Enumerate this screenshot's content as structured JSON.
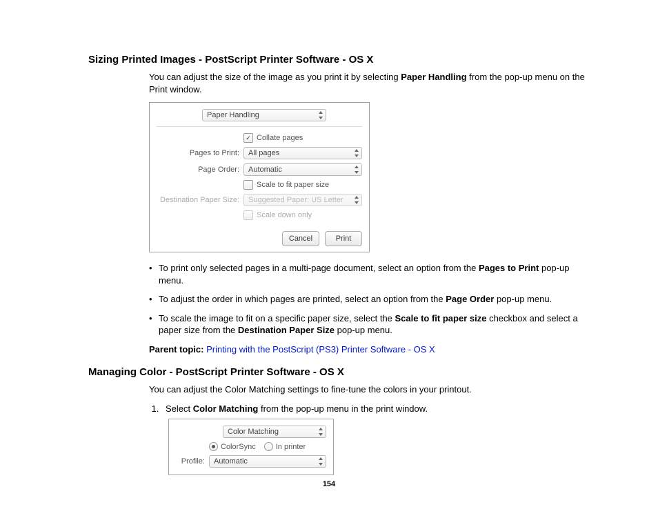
{
  "section1": {
    "heading": "Sizing Printed Images - PostScript Printer Software - OS X",
    "intro_pre": "You can adjust the size of the image as you print it by selecting ",
    "intro_bold": "Paper Handling",
    "intro_post": " from the pop-up menu on the Print window.",
    "dialog": {
      "menu": "Paper Handling",
      "collate": "Collate pages",
      "pages_label": "Pages to Print:",
      "pages_value": "All pages",
      "order_label": "Page Order:",
      "order_value": "Automatic",
      "scale_fit": "Scale to fit paper size",
      "dest_label": "Destination Paper Size:",
      "dest_value": "Suggested Paper: US Letter",
      "scale_down": "Scale down only",
      "cancel": "Cancel",
      "print": "Print"
    },
    "bullets": {
      "b1a": "To print only selected pages in a multi-page document, select an option from the ",
      "b1b": "Pages to Print",
      "b1c": " pop-up menu.",
      "b2a": "To adjust the order in which pages are printed, select an option from the ",
      "b2b": "Page Order",
      "b2c": " pop-up menu.",
      "b3a": "To scale the image to fit on a specific paper size, select the ",
      "b3b": "Scale to fit paper size",
      "b3c": " checkbox and select a paper size from the ",
      "b3d": "Destination Paper Size",
      "b3e": " pop-up menu."
    },
    "parent_label": "Parent topic: ",
    "parent_link": "Printing with the PostScript (PS3) Printer Software - OS X"
  },
  "section2": {
    "heading": "Managing Color - PostScript Printer Software - OS X",
    "intro": "You can adjust the Color Matching settings to fine-tune the colors in your printout.",
    "step1a": "Select ",
    "step1b": "Color Matching",
    "step1c": " from the pop-up menu in the print window.",
    "dialog": {
      "menu": "Color Matching",
      "opt1": "ColorSync",
      "opt2": "In printer",
      "profile_label": "Profile:",
      "profile_value": "Automatic"
    }
  },
  "page_number": "154"
}
